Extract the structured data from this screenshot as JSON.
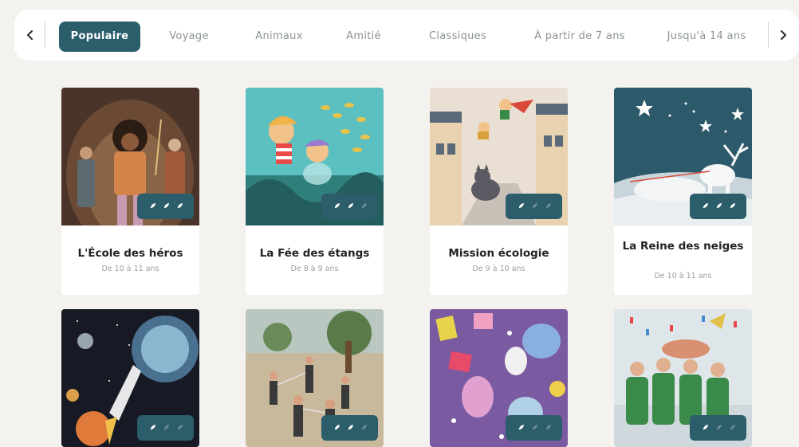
{
  "nav": {
    "prev_icon": "chevron-left-icon",
    "next_icon": "chevron-right-icon",
    "tabs": [
      {
        "label": "Populaire",
        "active": true
      },
      {
        "label": "Voyage",
        "active": false
      },
      {
        "label": "Animaux",
        "active": false
      },
      {
        "label": "Amitié",
        "active": false
      },
      {
        "label": "Classiques",
        "active": false
      },
      {
        "label": "À partir de 7 ans",
        "active": false
      },
      {
        "label": "Jusqu'à 14 ans",
        "active": false
      }
    ]
  },
  "books": [
    {
      "title": "L'École des héros",
      "age": "De 10 à 11 ans",
      "rating": 3,
      "illustration": "cave-heroes"
    },
    {
      "title": "La Fée des étangs",
      "age": "De 8 à 9 ans",
      "rating": 2,
      "illustration": "underwater-fairies"
    },
    {
      "title": "Mission écologie",
      "age": "De 9 à 10 ans",
      "rating": 1,
      "illustration": "flying-kids-street-cat"
    },
    {
      "title": "La Reine des neiges",
      "age": "De 10 à 11 ans",
      "rating": 3,
      "illustration": "snow-sleigh-reindeer"
    },
    {
      "title": "",
      "age": "",
      "rating": 1,
      "illustration": "space-rocket-planets"
    },
    {
      "title": "",
      "age": "",
      "rating": 2,
      "illustration": "sword-fight-village"
    },
    {
      "title": "",
      "age": "",
      "rating": 1,
      "illustration": "colorful-monsters-party"
    },
    {
      "title": "",
      "age": "",
      "rating": 1,
      "illustration": "football-celebration"
    }
  ],
  "colors": {
    "accent": "#2b5d6b",
    "background": "#f4f2ef",
    "card": "#ffffff",
    "title_text": "#232323",
    "muted_text": "#8c9395",
    "star_filled": "#ffffff",
    "star_empty": "#6c8d96"
  }
}
